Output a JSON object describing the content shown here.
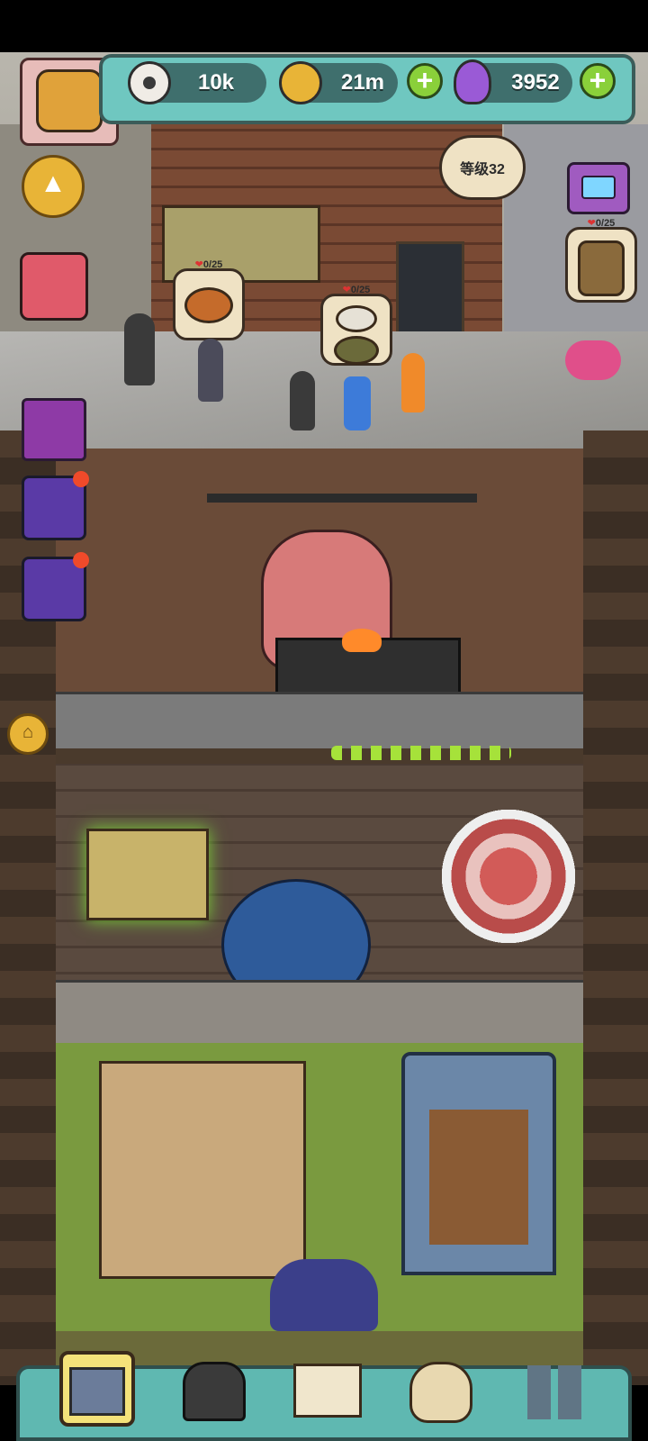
{
  "resources": {
    "eyeballs": {
      "value": "10k",
      "icon": "eyeball-icon"
    },
    "coins": {
      "value": "21m",
      "icon": "coin-icon"
    },
    "potion": {
      "value": "3952",
      "icon": "potion-icon"
    }
  },
  "building": {
    "level_label": "等级32"
  },
  "orders": [
    {
      "count": "0/25"
    },
    {
      "count": "0/25"
    },
    {
      "count": "0/25"
    }
  ],
  "side_buttons": [
    "scroll-up",
    "gift-box",
    "cards",
    "gift",
    "gift",
    "home"
  ],
  "bottom_nav": [
    "building",
    "monster-gate",
    "book",
    "coin-sack",
    "grid-menu"
  ]
}
